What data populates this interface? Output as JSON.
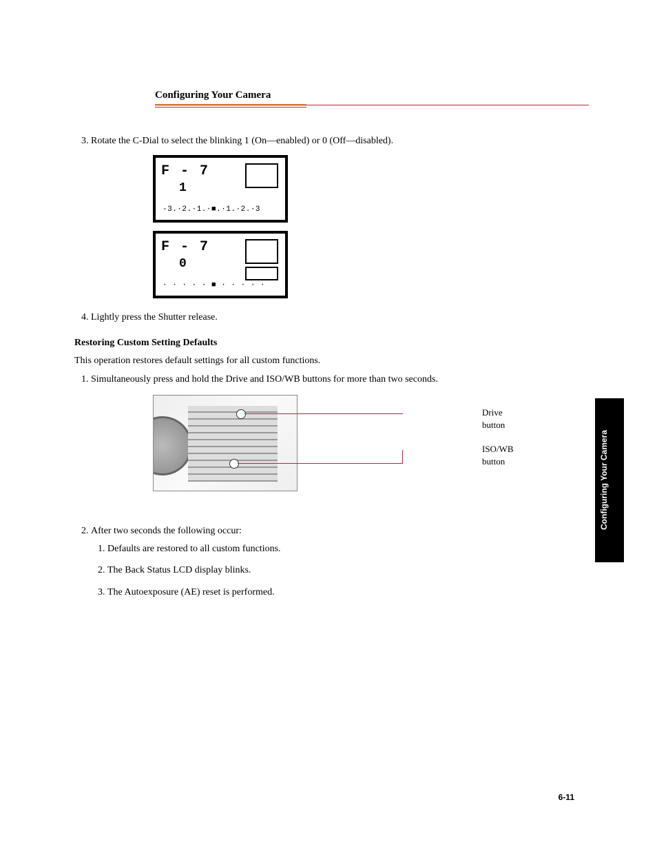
{
  "header": {
    "title": "Configuring Your Camera"
  },
  "steps": {
    "s3": {
      "num": "3",
      "text_a": "Rotate the C-Dial to select the blinking ",
      "text_b": " (On—enabled) or ",
      "text_c": " (Off—disabled)."
    },
    "s4": {
      "num": "4",
      "text": "Lightly press the Shutter release."
    }
  },
  "lcd": {
    "top": "F - 7",
    "val_on": "1",
    "val_off": "0",
    "scale_1": "-3.·2.·1.·■.·1.·2.·3",
    "scale_2": "· · · · · ■ · · · · ·"
  },
  "subsection": {
    "title": "Restoring Custom Setting Defaults",
    "intro": "This operation restores default settings for all custom functions.",
    "s1": {
      "num": "1",
      "text": "Simultaneously press and hold the Drive and ISO/WB buttons for more than two seconds."
    },
    "s2": {
      "num": "2",
      "text": "After two seconds the following occur:",
      "bullets": {
        "a": "Defaults are restored to all custom functions.",
        "b": "The Back Status LCD display blinks.",
        "c": "The Autoexposure (AE) reset is performed."
      }
    }
  },
  "diagram": {
    "label_drive": "Drive button",
    "label_iso": "ISO/WB button"
  },
  "side_tab": "Configuring Your Camera",
  "page_number": "6-11"
}
